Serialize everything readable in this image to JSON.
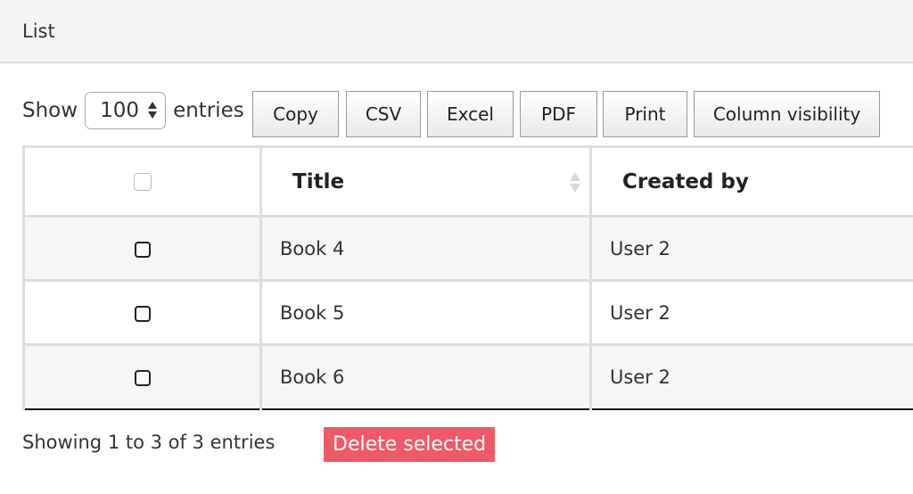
{
  "panel": {
    "title": "List"
  },
  "length_menu": {
    "show_label": "Show",
    "selected": "100",
    "entries_label": "entries"
  },
  "buttons": [
    {
      "label": "Copy"
    },
    {
      "label": "CSV"
    },
    {
      "label": "Excel"
    },
    {
      "label": "PDF"
    },
    {
      "label": "Print"
    },
    {
      "label": "Column visibility"
    }
  ],
  "table": {
    "columns": [
      "",
      "Title",
      "Created by"
    ],
    "rows": [
      {
        "checked": false,
        "title": "Book 4",
        "created_by": "User 2"
      },
      {
        "checked": false,
        "title": "Book 5",
        "created_by": "User 2"
      },
      {
        "checked": false,
        "title": "Book 6",
        "created_by": "User 2"
      }
    ]
  },
  "footer": {
    "info": "Showing 1 to 3 of 3 entries",
    "delete_label": "Delete selected",
    "delete_color": "#f05a66"
  }
}
